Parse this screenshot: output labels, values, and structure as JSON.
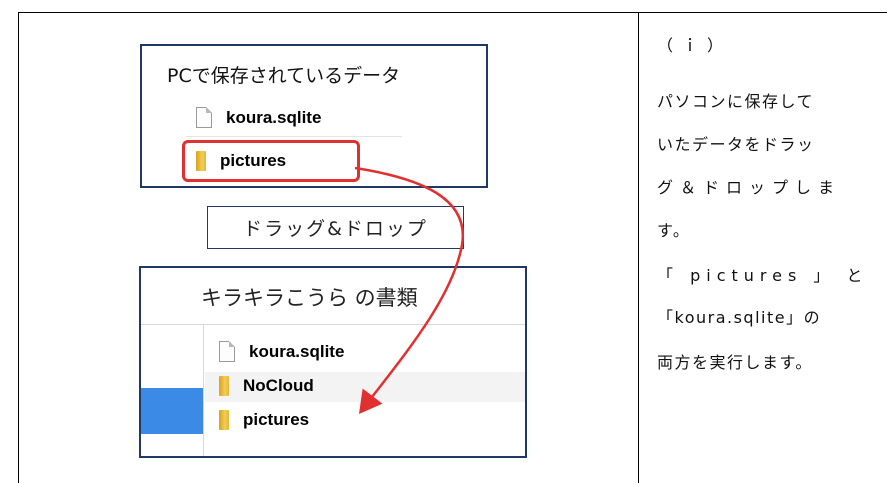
{
  "pc_panel": {
    "title": "PCで保存されているデータ",
    "files": [
      {
        "name": "koura.sqlite",
        "icon": "document-icon"
      },
      {
        "name": "pictures",
        "icon": "folder-icon"
      }
    ],
    "highlight_color": "#e03030"
  },
  "drag_drop_label": "ドラッグ&ドロップ",
  "app_panel": {
    "title": "キラキラこうら の書類",
    "files": [
      {
        "name": "koura.sqlite",
        "icon": "document-icon"
      },
      {
        "name": "NoCloud",
        "icon": "folder-icon"
      },
      {
        "name": "pictures",
        "icon": "folder-icon"
      }
    ],
    "accent_color": "#3b8ae6"
  },
  "instructions": {
    "lines": [
      "（ｉ）",
      "パソコンに保存して",
      "いたデータをドラッ",
      "グ＆ドロップしま",
      "す。",
      "「 pictures 」 と",
      "「koura.sqlite」の",
      "両方を実行します。"
    ]
  },
  "colors": {
    "frame": "#1f3864",
    "arrow": "#e03030"
  }
}
